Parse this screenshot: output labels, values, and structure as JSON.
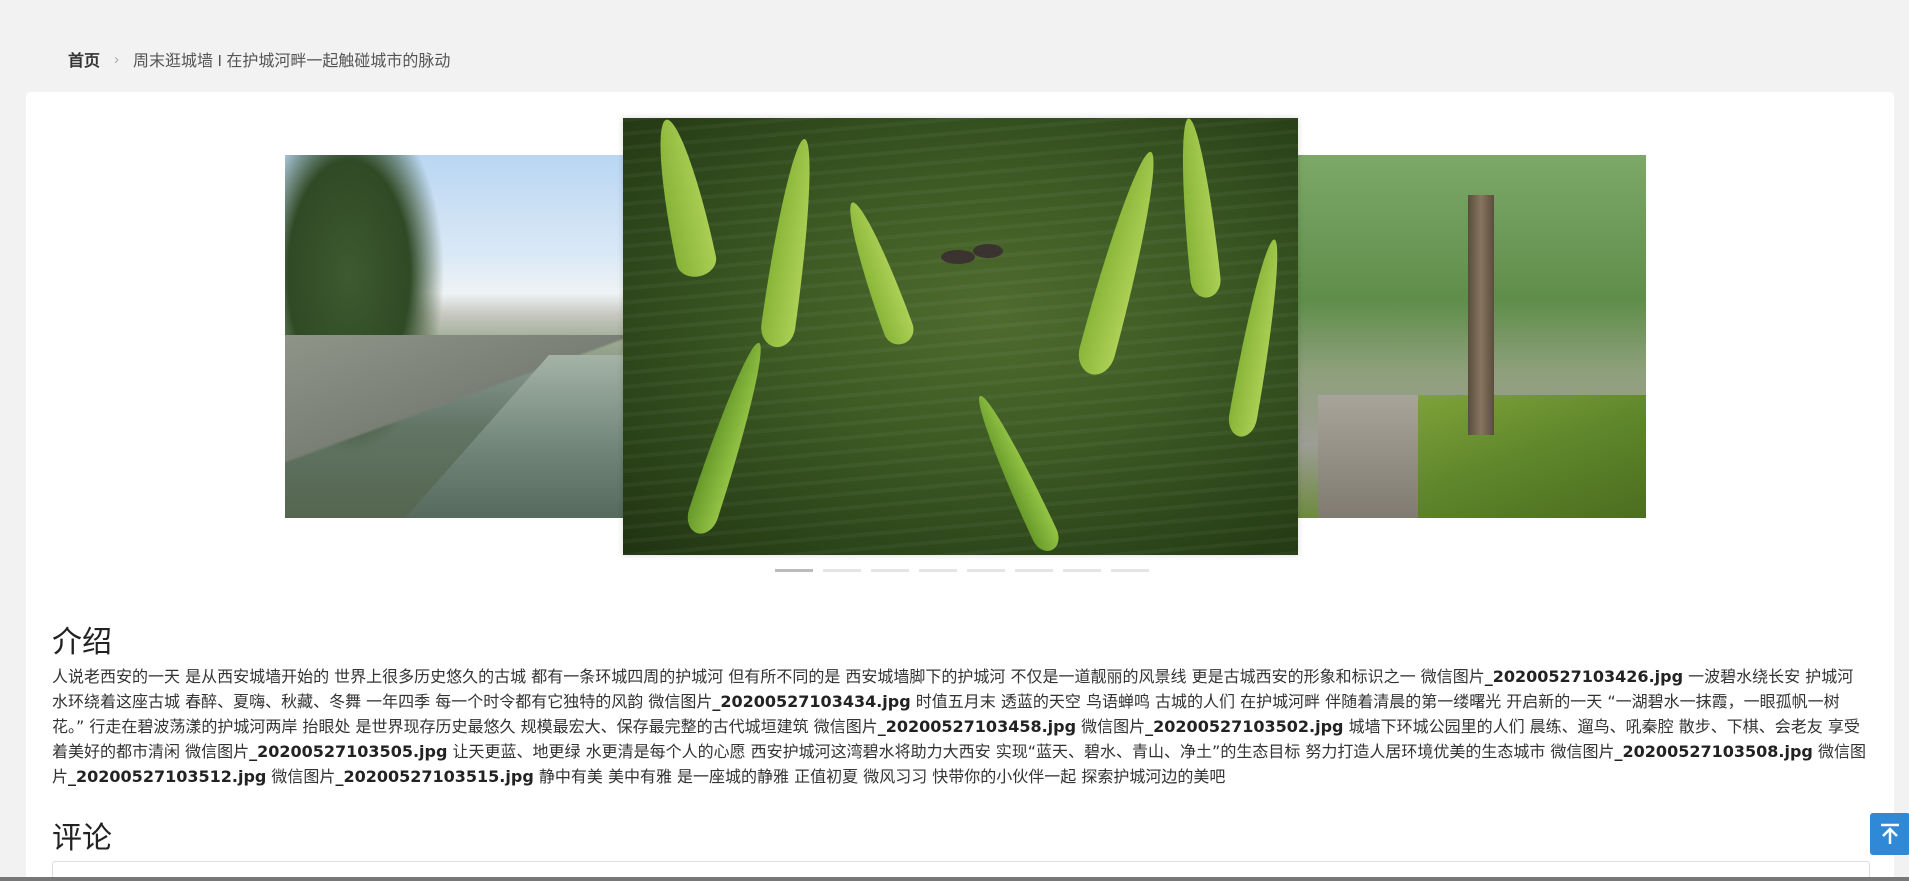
{
  "breadcrumb": {
    "home": "首页",
    "current": "周末逛城墙 I 在护城河畔一起触碰城市的脉动"
  },
  "carousel": {
    "slides": [
      {
        "description_icon": "left-slide-image"
      },
      {
        "description_icon": "center-slide-image"
      },
      {
        "description_icon": "right-slide-image"
      }
    ],
    "indicator_count": 8,
    "active_index": 0
  },
  "intro": {
    "title": "介绍",
    "segments": [
      {
        "t": "人说老西安的一天 是从西安城墙开始的 世界上很多历史悠久的古城 都有一条环城四周的护城河 但有所不同的是 西安城墙脚下的护城河 不仅是一道靓丽的风景线 更是古城西安的形象和标识之一 微信图片",
        "b": false
      },
      {
        "t": "_20200527103426.jpg",
        "b": true
      },
      {
        "t": " 一波碧水绕长安 护城河水环绕着这座古城 春醉、夏嗨、秋藏、冬舞 一年四季 每一个时令都有它独特的风韵 微信图片",
        "b": false
      },
      {
        "t": "_20200527103434.jpg",
        "b": true
      },
      {
        "t": " 时值五月末 透蓝的天空 鸟语蝉鸣 古城的人们 在护城河畔 伴随着清晨的第一缕曙光 开启新的一天 “一湖碧水一抹霞，一眼孤帆一树花。” 行走在碧波荡漾的护城河两岸 抬眼处 是世界现存历史最悠久 规模最宏大、保存最完整的古代城垣建筑 微信图片",
        "b": false
      },
      {
        "t": "_20200527103458.jpg",
        "b": true
      },
      {
        "t": " 微信图片",
        "b": false
      },
      {
        "t": "_20200527103502.jpg",
        "b": true
      },
      {
        "t": " 城墙下环城公园里的人们 晨练、遛鸟、吼秦腔 散步、下棋、会老友 享受着美好的都市清闲 微信图片",
        "b": false
      },
      {
        "t": "_20200527103505.jpg",
        "b": true
      },
      {
        "t": " 让天更蓝、地更绿 水更清是每个人的心愿 西安护城河这湾碧水将助力大西安 实现“蓝天、碧水、青山、净土”的生态目标 努力打造人居环境优美的生态城市 微信图片",
        "b": false
      },
      {
        "t": "_20200527103508.jpg",
        "b": true
      },
      {
        "t": " 微信图片",
        "b": false
      },
      {
        "t": "_20200527103512.jpg",
        "b": true
      },
      {
        "t": " 微信图片",
        "b": false
      },
      {
        "t": "_20200527103515.jpg",
        "b": true
      },
      {
        "t": " 静中有美 美中有雅 是一座城的静雅 正值初夏 微风习习 快带你的小伙伴一起 探索护城河边的美吧",
        "b": false
      }
    ]
  },
  "comments": {
    "title": "评论"
  },
  "back_to_top": {
    "icon": "arrow-up-to-top-icon"
  },
  "colors": {
    "accent": "#2f89d6",
    "background": "#f2f2f2"
  }
}
